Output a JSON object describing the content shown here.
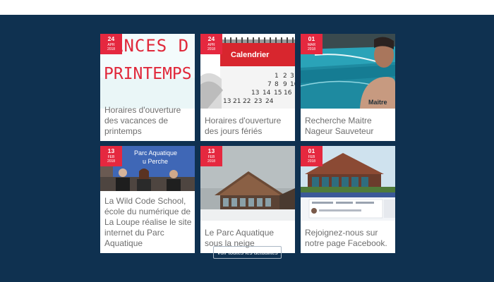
{
  "section": {
    "background_color": "#0f3150",
    "badge_color": "#e5283f"
  },
  "cards": [
    {
      "day": "24",
      "month": "APR",
      "year": "2018",
      "title": "Horaires d'ouverture des vacances de printemps",
      "image_text": [
        "ANCES D",
        "PRINTEMPS"
      ]
    },
    {
      "day": "24",
      "month": "APR",
      "year": "2018",
      "title": "Horaires d'ouverture des jours fériés",
      "image_text": [
        "Calendrier"
      ]
    },
    {
      "day": "01",
      "month": "MAR",
      "year": "2018",
      "title": "Recherche Maitre Nageur Sauveteur",
      "image_text": [
        "Maitre"
      ]
    },
    {
      "day": "13",
      "month": "FEB",
      "year": "2018",
      "title": "La Wild Code School, école du numérique de La Loupe réalise le site internet du Parc Aquatique",
      "image_text": [
        "Parc Aquatique",
        "u Perche"
      ]
    },
    {
      "day": "13",
      "month": "FEB",
      "year": "2018",
      "title": "Le Parc Aquatique sous la neige",
      "image_text": []
    },
    {
      "day": "01",
      "month": "FEB",
      "year": "2018",
      "title": "Rejoignez-nous sur notre page Facebook.",
      "image_text": []
    }
  ],
  "all_news_button": {
    "label": "Voir toutes les actualités"
  }
}
